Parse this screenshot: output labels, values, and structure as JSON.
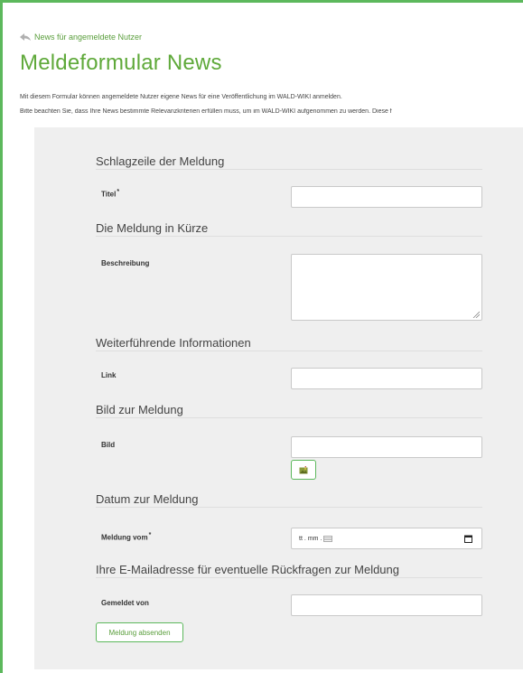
{
  "back_link": {
    "label": "News für angemeldete Nutzer"
  },
  "page": {
    "title": "Meldeformular News",
    "intro_line1": "Mit diesem Formular können angemeldete Nutzer eigene News für eine Veröffentlichung im WALD-WIKI anmelden.",
    "intro_line2": "Bitte beachten Sie, dass Ihre News bestimmte Relevanzkriterien erfüllen muss, um im WALD-WIKI aufgenommen zu werden. Diese f"
  },
  "sections": {
    "headline": {
      "title": "Schlagzeile der Meldung",
      "field_label": "Titel",
      "required_mark": "*"
    },
    "summary": {
      "title": "Die Meldung in Kürze",
      "field_label": "Beschreibung"
    },
    "more_info": {
      "title": "Weiterführende Informationen",
      "field_label": "Link"
    },
    "image": {
      "title": "Bild zur Meldung",
      "field_label": "Bild"
    },
    "date": {
      "title": "Datum zur Meldung",
      "field_label": "Meldung vom",
      "required_mark": "*",
      "placeholder_day": "tt",
      "placeholder_month": "mm"
    },
    "contact": {
      "title": "Ihre E-Mailadresse für eventuelle Rückfragen zur Meldung",
      "field_label": "Gemeldet von"
    }
  },
  "submit": {
    "label": "Meldung absenden"
  },
  "colors": {
    "accent": "#5fa93a",
    "panel": "#efefef",
    "border": "#c9c9c9"
  }
}
